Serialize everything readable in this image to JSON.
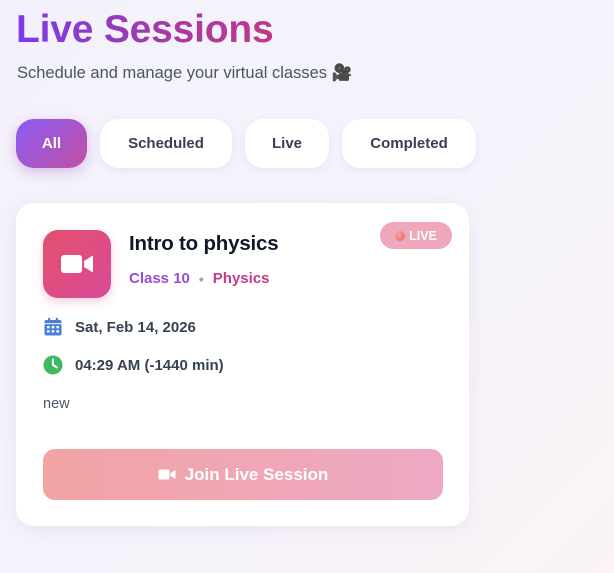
{
  "header": {
    "title": "Live Sessions",
    "subtitle": "Schedule and manage your virtual classes 🎥"
  },
  "tabs": [
    {
      "label": "All",
      "active": true
    },
    {
      "label": "Scheduled",
      "active": false
    },
    {
      "label": "Live",
      "active": false
    },
    {
      "label": "Completed",
      "active": false
    }
  ],
  "session": {
    "icon": "video-camera-icon",
    "title": "Intro to physics",
    "class_label": "Class 10",
    "separator": "•",
    "subject": "Physics",
    "status_badge": "LIVE",
    "date": "Sat, Feb 14, 2026",
    "time": "04:29 AM (-1440 min)",
    "description": "new",
    "join_label": "Join Live Session"
  },
  "colors": {
    "accent_purple": "#8b5cf6",
    "accent_pink": "#c14fa0",
    "live_badge": "#efa7bb",
    "join_button_start": "#f0a4a4",
    "join_button_end": "#efa8c4",
    "calendar_icon": "#4a7fd4",
    "clock_icon": "#3fb95f"
  }
}
